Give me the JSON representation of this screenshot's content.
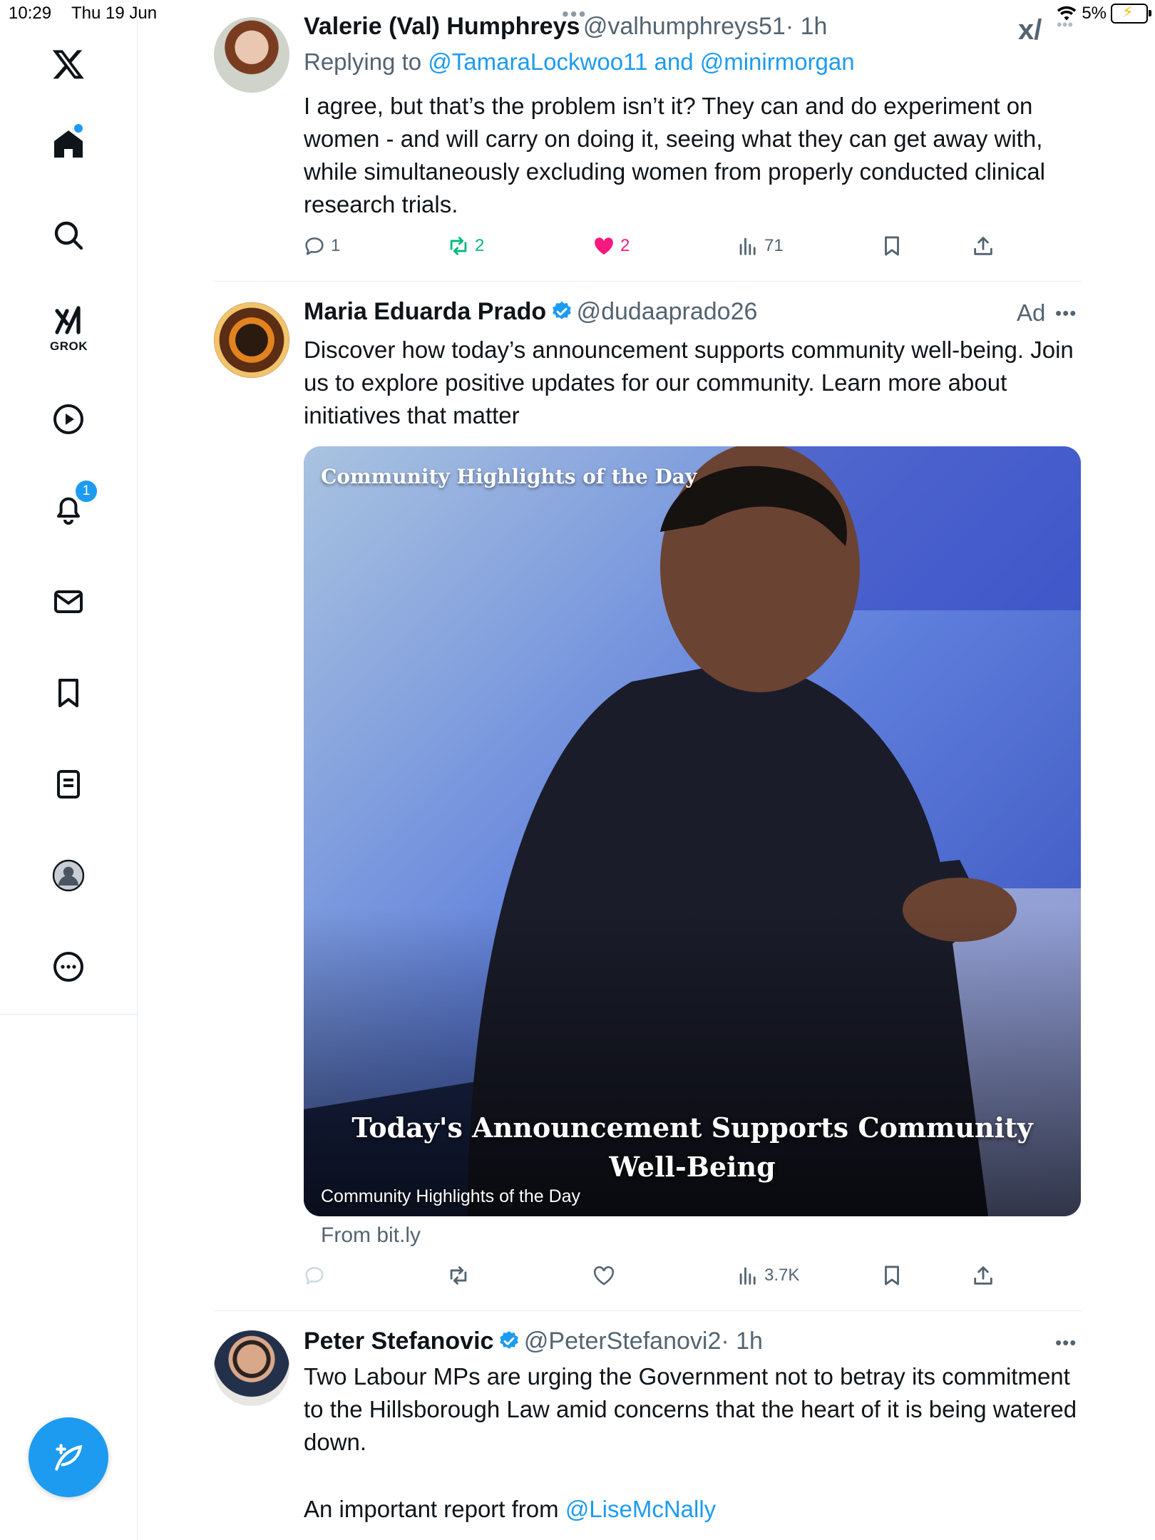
{
  "status_bar": {
    "time": "10:29",
    "date": "Thu 19 Jun",
    "battery": "5%"
  },
  "sidebar": {
    "items": [
      {
        "name": "home",
        "badge_dot": true
      },
      {
        "name": "explore"
      },
      {
        "name": "grok",
        "label": "GROK"
      },
      {
        "name": "video"
      },
      {
        "name": "notifications",
        "badge": "1"
      },
      {
        "name": "messages"
      },
      {
        "name": "bookmarks"
      },
      {
        "name": "lists"
      },
      {
        "name": "profile"
      },
      {
        "name": "more"
      }
    ]
  },
  "tweets": [
    {
      "name": "Valerie (Val) Humphreys",
      "handle": "@valhumphreys51",
      "time": "· 1h",
      "replying_prefix": "Replying to",
      "replying_to": "@TamaraLockwoo11 and @minirmorgan",
      "text": "I agree, but that’s the problem isn’t it? They can and do experiment on women - and will carry on doing it, seeing what they can get away with, while simultaneously excluding women from properly conducted clinical research trials.",
      "replies": "1",
      "reposts": "2",
      "likes": "2",
      "views": "71"
    },
    {
      "name": "Maria Eduarda Prado",
      "handle": "@dudaaprado26",
      "ad": "Ad",
      "text": "Discover how today’s announcement supports community well-being. Join us to explore positive updates for our community. Learn more about initiatives that matter",
      "card_top": "Community Highlights of the Day",
      "card_headline_1": "Today's Announcement Supports Community",
      "card_headline_2": "Well-Being",
      "card_caption": "Community Highlights of the Day",
      "from": "From bit.ly",
      "views": "3.7K"
    },
    {
      "name": "Peter Stefanovic",
      "handle": "@PeterStefanovi2",
      "time": "· 1h",
      "text": "Two Labour MPs are urging the Government not to betray its commitment to the Hillsborough Law amid concerns that the heart of it is being watered down.",
      "text2_prefix": "An important report from",
      "text2_link": "@LiseMcNally"
    }
  ],
  "colors": {
    "accent": "#1d9bf0",
    "repost": "#00ba7c",
    "like": "#f91880",
    "secondary": "#536471"
  }
}
